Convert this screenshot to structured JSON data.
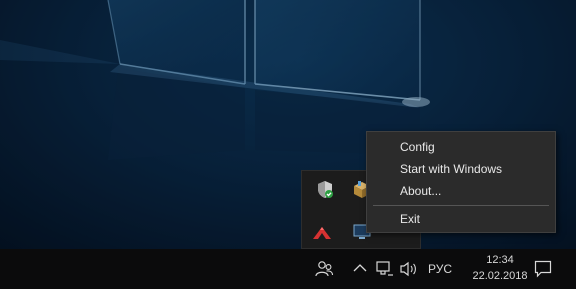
{
  "context_menu": {
    "items": [
      {
        "label": "Config"
      },
      {
        "label": "Start with Windows"
      },
      {
        "label": "About..."
      },
      {
        "label": "Exit"
      }
    ]
  },
  "tray_overflow": {
    "icons": [
      "shield-check-icon",
      "package-icon",
      "red-arrow-app-icon",
      "monitor-icon"
    ]
  },
  "taskbar": {
    "language": "РУС",
    "time": "12:34",
    "date": "22.02.2018",
    "icons": [
      "people-icon",
      "chevron-up-icon",
      "network-icon",
      "volume-icon",
      "action-center-icon"
    ]
  },
  "colors": {
    "taskbar_bg": "#0b0b0c",
    "menu_bg": "#2b2b2b",
    "wallpaper_glow": "#2f78b0"
  }
}
